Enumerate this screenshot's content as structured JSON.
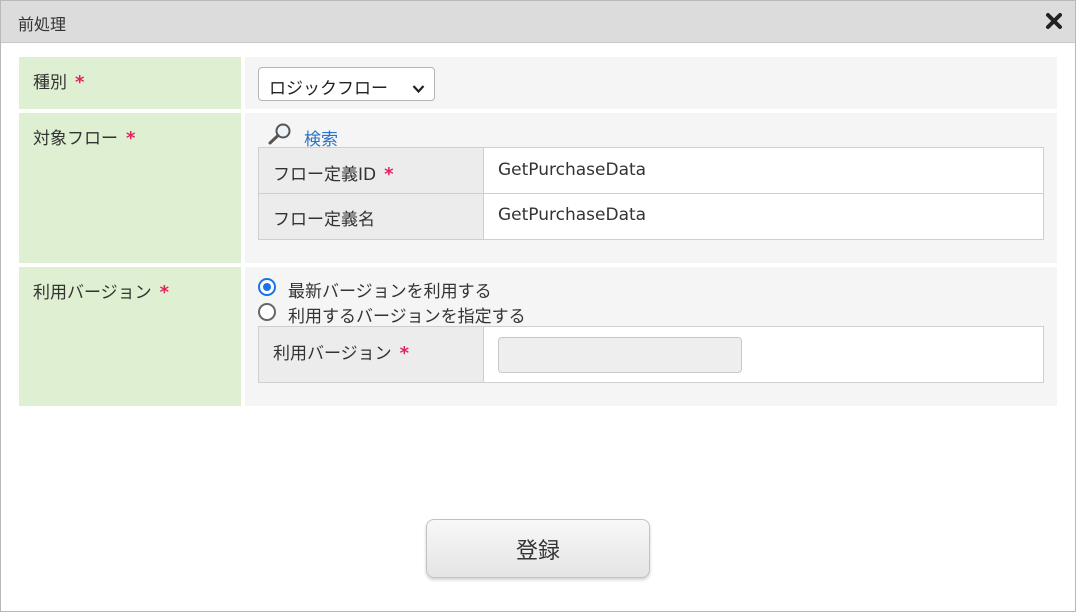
{
  "dialog": {
    "title": "前処理",
    "close_icon": "close-icon"
  },
  "rows": {
    "type": {
      "label": "種別",
      "required_mark": "*",
      "select_value": "ロジックフロー"
    },
    "target_flow": {
      "label": "対象フロー",
      "required_mark": "*",
      "search_label": "検索",
      "flow_id_label": "フロー定義ID",
      "flow_id_required": "*",
      "flow_id_value": "GetPurchaseData",
      "flow_name_label": "フロー定義名",
      "flow_name_value": "GetPurchaseData"
    },
    "version": {
      "label": "利用バージョン",
      "required_mark": "*",
      "option_latest": "最新バージョンを利用する",
      "option_specify": "利用するバージョンを指定する",
      "selected": "latest",
      "version_label": "利用バージョン",
      "version_required": "*",
      "version_value": ""
    }
  },
  "footer": {
    "submit_label": "登録"
  },
  "colors": {
    "label_bg": "#dff0d2",
    "required": "#e0245e",
    "link": "#2a73c8",
    "radio_accent": "#1a73e8"
  }
}
